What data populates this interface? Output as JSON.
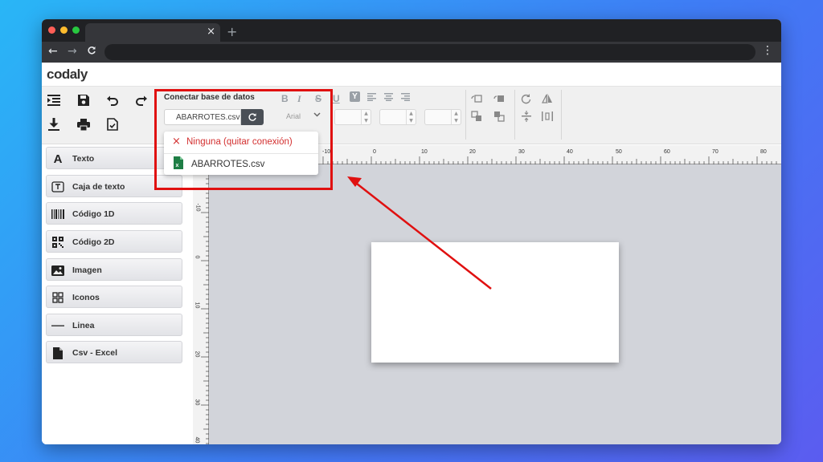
{
  "browser": {
    "tab_close": "×",
    "new_tab": "+",
    "back": "←",
    "forward": "→",
    "reload": "C",
    "menu": "⋮"
  },
  "app": {
    "logo_text": "codaly"
  },
  "toolbar": {
    "db_label": "Conectar base de datos",
    "db_selected": "ABARROTES.csv",
    "font_value": "Arial",
    "colors": {
      "accent": "#e01010",
      "button_dark": "#4a4f56"
    }
  },
  "dropdown": {
    "option_none": "Ninguna (quitar conexión)",
    "option_none_icon": "×",
    "option_file": "ABARROTES.csv",
    "colors": {
      "none": "#d32f2f",
      "file_icon": "#1e7e45"
    }
  },
  "sidebar": {
    "items": [
      {
        "label": "Texto",
        "icon": "text-icon"
      },
      {
        "label": "Caja de texto",
        "icon": "textbox-icon"
      },
      {
        "label": "Código 1D",
        "icon": "barcode-icon"
      },
      {
        "label": "Código 2D",
        "icon": "qrcode-icon"
      },
      {
        "label": "Imagen",
        "icon": "image-icon"
      },
      {
        "label": "Iconos",
        "icon": "grid-icon"
      },
      {
        "label": "Linea",
        "icon": "line-icon"
      },
      {
        "label": "Csv - Excel",
        "icon": "file-icon"
      }
    ]
  },
  "ruler": {
    "top_labels": [
      "-10",
      "0",
      "10",
      "20",
      "30",
      "40",
      "50",
      "60",
      "70",
      "80"
    ],
    "left_labels": [
      "-10",
      "0",
      "10",
      "20",
      "30",
      "40"
    ]
  }
}
